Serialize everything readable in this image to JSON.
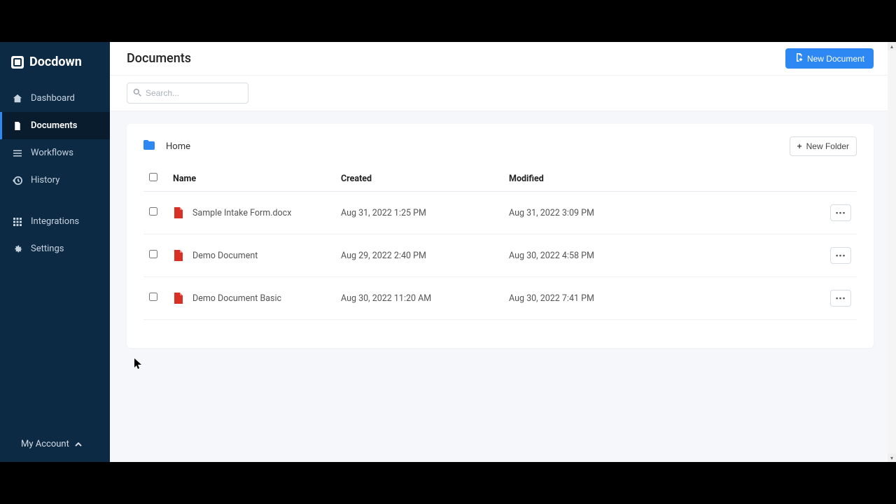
{
  "brand": {
    "name": "Docdown"
  },
  "sidebar": {
    "items": [
      {
        "label": "Dashboard",
        "icon": "home"
      },
      {
        "label": "Documents",
        "icon": "file"
      },
      {
        "label": "Workflows",
        "icon": "flow"
      },
      {
        "label": "History",
        "icon": "history"
      },
      {
        "label": "Integrations",
        "icon": "grid"
      },
      {
        "label": "Settings",
        "icon": "gear"
      }
    ],
    "account_label": "My Account"
  },
  "header": {
    "title": "Documents",
    "new_document_label": "New Document"
  },
  "search": {
    "placeholder": "Search..."
  },
  "breadcrumb": {
    "root": "Home",
    "new_folder_label": "New Folder"
  },
  "table": {
    "columns": {
      "name": "Name",
      "created": "Created",
      "modified": "Modified"
    },
    "rows": [
      {
        "name": "Sample Intake Form.docx",
        "created": "Aug 31, 2022 1:25 PM",
        "modified": "Aug 31, 2022 3:09 PM"
      },
      {
        "name": "Demo Document",
        "created": "Aug 29, 2022 2:40 PM",
        "modified": "Aug 30, 2022 4:58 PM"
      },
      {
        "name": "Demo Document Basic",
        "created": "Aug 30, 2022 11:20 AM",
        "modified": "Aug 30, 2022 7:41 PM"
      }
    ]
  }
}
